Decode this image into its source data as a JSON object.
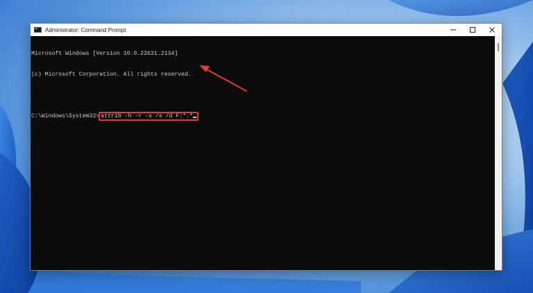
{
  "window": {
    "title": "Administrator: Command Prompt",
    "controls": {
      "minimize": "minimize",
      "maximize": "maximize",
      "close": "close"
    }
  },
  "console": {
    "lines": [
      "Microsoft Windows [Version 10.0.22621.2134]",
      "(c) Microsoft Corporation. All rights reserved.",
      ""
    ],
    "prompt": "C:\\Windows\\System32>",
    "command": "attrib -h -r -s /s /d F:*.*"
  },
  "annotation": {
    "highlight_color": "#e53935"
  },
  "icons": {
    "app": "command-prompt-icon",
    "minimize": "minimize-icon",
    "maximize": "maximize-icon",
    "close": "close-icon",
    "annotation": "arrow-icon"
  }
}
